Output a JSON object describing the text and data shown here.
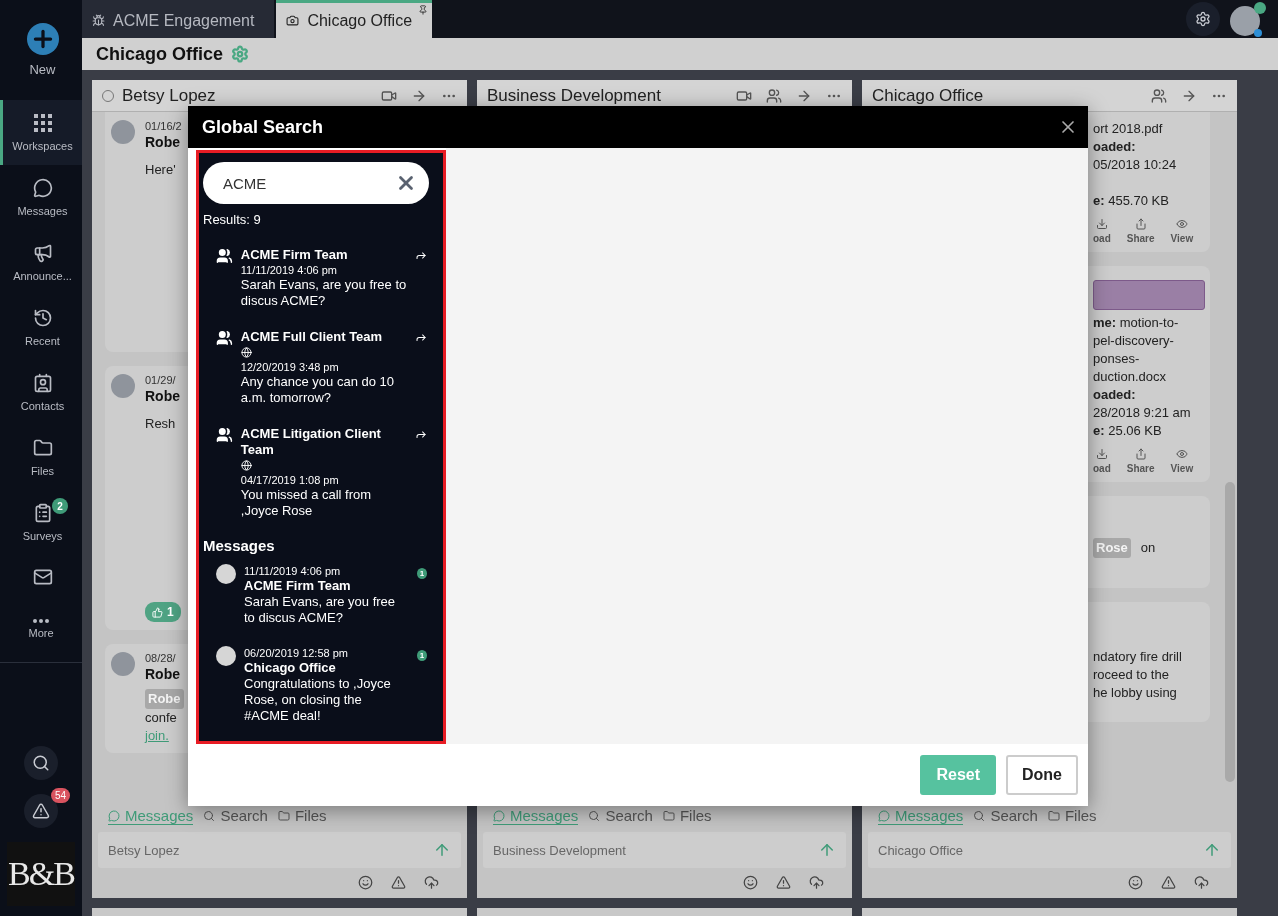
{
  "sidebar": {
    "items": [
      {
        "label": "New",
        "kind": "new",
        "selected": false
      },
      {
        "label": "Workspaces",
        "kind": "nav",
        "selected": true
      },
      {
        "label": "Messages",
        "kind": "nav",
        "selected": false
      },
      {
        "label": "Announce...",
        "kind": "nav",
        "selected": false
      },
      {
        "label": "Recent",
        "kind": "nav",
        "selected": false
      },
      {
        "label": "Contacts",
        "kind": "nav",
        "selected": false
      },
      {
        "label": "Files",
        "kind": "nav",
        "selected": false
      },
      {
        "label": "Surveys",
        "kind": "nav",
        "selected": false,
        "badge": "2"
      },
      {
        "kind": "nav",
        "selected": false
      }
    ],
    "more": "More",
    "alerts_badge": "54",
    "logo": "B&B"
  },
  "tabs": [
    {
      "label": "ACME Engagement",
      "selected": false
    },
    {
      "label": "Chicago Office",
      "selected": true
    }
  ],
  "workspace": {
    "title": "Chicago Office"
  },
  "columns": [
    {
      "title": "Betsy Lopez",
      "kind": "direct",
      "cards": [
        {
          "kind": "message",
          "date": "01/16/2",
          "author": "Robe",
          "lines": [
            "Here'"
          ]
        },
        {
          "kind": "message",
          "date": "01/29/",
          "author": "Robe",
          "lines": [
            "Resh"
          ],
          "likes": "1"
        },
        {
          "kind": "message",
          "date": "08/28/",
          "author": "Robe",
          "mention": "Robe",
          "lines": [
            "confe"
          ],
          "link": "join."
        }
      ],
      "composer": {
        "tabs": [
          {
            "label": "Messages",
            "selected": true
          },
          {
            "label": "Search",
            "selected": false
          },
          {
            "label": "Files",
            "selected": false
          }
        ],
        "placeholder": "Betsy Lopez"
      }
    },
    {
      "title": "Business Development",
      "kind": "group",
      "composer": {
        "tabs": [
          {
            "label": "Messages",
            "selected": true
          },
          {
            "label": "Search",
            "selected": false
          },
          {
            "label": "Files",
            "selected": false
          }
        ],
        "placeholder": "Business Development"
      }
    },
    {
      "title": "Chicago Office",
      "kind": "team",
      "cards": [
        {
          "kind": "file",
          "lines": [
            "ort 2018.pdf",
            "**oaded:**",
            "05/2018 10:24",
            "**e:** 455.70 KB"
          ],
          "actions": [
            "oad",
            "Share",
            "View"
          ]
        },
        {
          "kind": "file",
          "preview": true,
          "lines": [
            "**me:** motion-to-",
            "pel-discovery-",
            "ponses-",
            "duction.docx",
            "**oaded:**",
            "28/2018 9:21 am",
            "**e:** 25.06 KB"
          ],
          "actions": [
            "oad",
            "Share",
            "View"
          ]
        },
        {
          "kind": "mention",
          "mention": "Rose",
          "text": "on"
        },
        {
          "kind": "text",
          "lines": [
            "ndatory fire drill",
            "roceed to the",
            "he lobby using"
          ]
        }
      ],
      "composer": {
        "tabs": [
          {
            "label": "Messages",
            "selected": true
          },
          {
            "label": "Search",
            "selected": false
          },
          {
            "label": "Files",
            "selected": false
          }
        ],
        "placeholder": "Chicago Office"
      }
    }
  ],
  "modal": {
    "title": "Global Search",
    "search": {
      "value": "ACME"
    },
    "results_count": "Results: 9",
    "teams": [
      {
        "name": "ACME Firm Team",
        "external": false,
        "date": "11/11/2019 4:06 pm",
        "text": "Sarah Evans, are you free to discus ACME?"
      },
      {
        "name": "ACME Full Client Team",
        "external": true,
        "date": "12/20/2019 3:48 pm",
        "text": "Any chance you can do 10 a.m. tomorrow?"
      },
      {
        "name": "ACME Litigation Client Team",
        "external": true,
        "date": "04/17/2019 1:08 pm",
        "text": "You missed a call from ,Joyce Rose"
      }
    ],
    "messages_heading": "Messages",
    "messages": [
      {
        "date": "11/11/2019 4:06 pm",
        "name": "ACME Firm Team",
        "text": "Sarah Evans, are you free to discus ACME?",
        "badge": "1"
      },
      {
        "date": "06/20/2019 12:58 pm",
        "name": "Chicago Office",
        "text": "Congratulations to ,Joyce Rose, on closing the #ACME deal!",
        "badge": "1"
      }
    ],
    "buttons": [
      {
        "label": "Reset",
        "kind": "primary"
      },
      {
        "label": "Done",
        "kind": "secondary"
      }
    ]
  }
}
